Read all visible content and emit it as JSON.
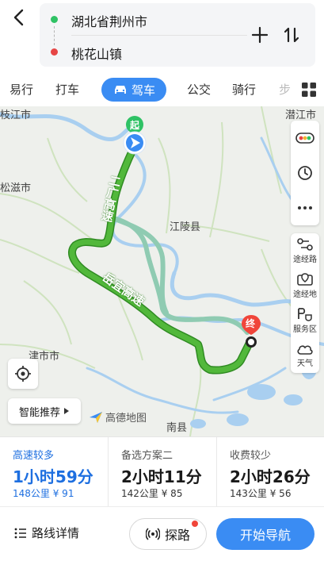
{
  "header": {
    "origin": "湖北省荆州市",
    "destination": "桃花山镇"
  },
  "tabs": {
    "items": [
      "易行",
      "打车",
      "公交",
      "骑行",
      "步"
    ],
    "active": "驾车"
  },
  "map": {
    "place_labels": [
      "江陵县",
      "松滋市",
      "枝江市",
      "潜江市",
      "津市市",
      "南县"
    ],
    "road_labels": [
      "二广高速",
      "岳宜高速"
    ],
    "start_label": "起",
    "end_label": "终",
    "tools": {
      "route_points": "途经路",
      "via_point": "途经地",
      "service_area": "服务区",
      "weather": "天气"
    },
    "smart_recommend": "智能推荐",
    "brand": "高德地图"
  },
  "options": [
    {
      "title": "高速较多",
      "time": "1小时59分",
      "distance": "148公里",
      "cost": "¥ 91",
      "active": true
    },
    {
      "title": "备选方案二",
      "time": "2小时11分",
      "distance": "142公里",
      "cost": "¥ 85",
      "active": false
    },
    {
      "title": "收费较少",
      "time": "2小时26分",
      "distance": "143公里",
      "cost": "¥ 56",
      "active": false
    }
  ],
  "bottom": {
    "detail": "路线详情",
    "explore": "探路",
    "navigate": "开始导航"
  },
  "colors": {
    "accent": "#3a8cf3",
    "route_main": "#52b83b",
    "route_alt": "#8fcbb2",
    "river": "#a9cff0"
  }
}
